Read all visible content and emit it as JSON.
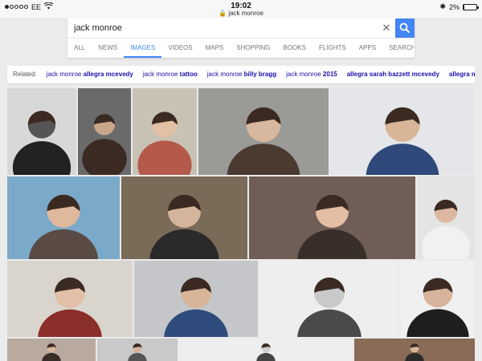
{
  "status": {
    "carrier": "EE",
    "time": "19:02",
    "url": "jack monroe",
    "battery_pct": "2%"
  },
  "search": {
    "query": "jack monroe"
  },
  "tabs": [
    "ALL",
    "NEWS",
    "IMAGES",
    "VIDEOS",
    "MAPS",
    "SHOPPING",
    "BOOKS",
    "FLIGHTS",
    "APPS",
    "SEARCH"
  ],
  "active_tab": "IMAGES",
  "related": {
    "label": "Related:",
    "items": [
      {
        "prefix": "jack monroe",
        "bold": "allegra mcevedy"
      },
      {
        "prefix": "jack monroe",
        "bold": "tattoo"
      },
      {
        "prefix": "jack monroe",
        "bold": "billy bragg"
      },
      {
        "prefix": "jack monroe",
        "bold": "2015"
      },
      {
        "prefix": "",
        "bold": "allegra sarah bazzett mcevedy"
      },
      {
        "prefix": "",
        "bold": "allegra mcevedy"
      }
    ]
  },
  "colors": {
    "accent": "#4285f4",
    "link": "#1a0dab"
  }
}
